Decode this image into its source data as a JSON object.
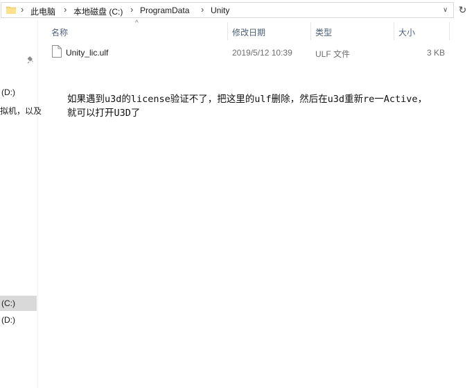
{
  "address": {
    "crumbs": [
      "此电脑",
      "本地磁盘 (C:)",
      "ProgramData",
      "Unity"
    ],
    "separator": "›",
    "dropdown_glyph": "∨",
    "refresh_glyph": "↻",
    "icons": {
      "location": "folder-icon",
      "refresh": "refresh-icon"
    }
  },
  "nav": {
    "items": [
      {
        "label": "(D:)"
      },
      {
        "label": "拟机，以及"
      },
      {
        "label": "(C:)",
        "selected": true
      },
      {
        "label": "(D:)"
      }
    ],
    "pin_icon": "pin-icon"
  },
  "columns": {
    "name": "名称",
    "date": "修改日期",
    "type": "类型",
    "size": "大小",
    "sort_glyph": "^"
  },
  "files": [
    {
      "name": "Unity_lic.ulf",
      "modified": "2019/5/12 10:39",
      "type": "ULF 文件",
      "size": "3 KB",
      "icon": "file-icon"
    }
  ],
  "note": {
    "line1": "如果遇到u3d的license验证不了，把这里的ulf删除，然后在u3d重新re一Active，",
    "line2": "就可以打开U3D了"
  },
  "colors": {
    "header_text": "#4c607a",
    "selected_bg": "#d9d9d9",
    "folder_yellow": "#f8d775"
  }
}
